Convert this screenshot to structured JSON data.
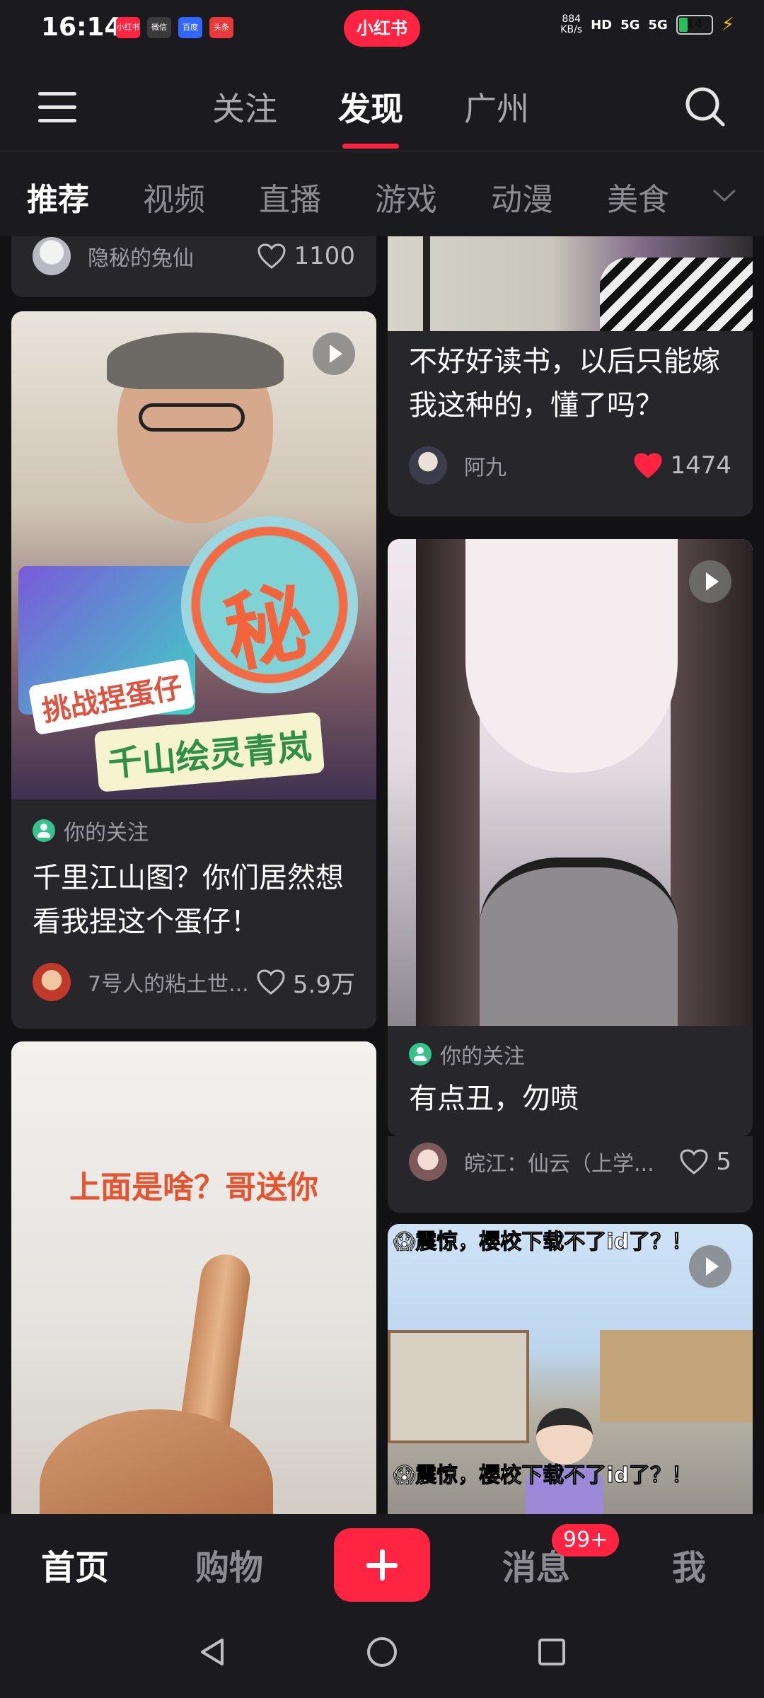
{
  "status_bar": {
    "time": "16:14",
    "app_icons": [
      {
        "name": "xiaohongshu-app-icon",
        "label": "小红书",
        "color": "#ff2442"
      },
      {
        "name": "wechat-app-icon",
        "label": "微信",
        "color": "#3a3a3a"
      },
      {
        "name": "baidu-app-icon",
        "label": "百度",
        "color": "#3366ff"
      },
      {
        "name": "toutiao-app-icon",
        "label": "头条",
        "color": "#e63939"
      }
    ],
    "brand_pill": "小红书",
    "net_speed_value": "884",
    "net_speed_unit": "KB/s",
    "hd_label": "HD",
    "signal_1": "5G",
    "signal_2": "5G",
    "battery": "14",
    "battery_level": 0.14
  },
  "header": {
    "tabs": [
      {
        "label": "关注",
        "active": false
      },
      {
        "label": "发现",
        "active": true
      },
      {
        "label": "广州",
        "active": false
      }
    ]
  },
  "categories": [
    {
      "label": "推荐",
      "active": true
    },
    {
      "label": "视频",
      "active": false
    },
    {
      "label": "直播",
      "active": false
    },
    {
      "label": "游戏",
      "active": false
    },
    {
      "label": "动漫",
      "active": false
    },
    {
      "label": "美食",
      "active": false
    }
  ],
  "feed": {
    "left": [
      {
        "author": "隐秘的兔仙",
        "likes": "1100",
        "liked": false
      },
      {
        "image_text_1": "秘",
        "image_text_2": "挑战捏蛋仔",
        "image_text_3": "千山绘灵青岚",
        "follow_tag": "你的关注",
        "title": "千里江山图？你们居然想看我捏这个蛋仔！",
        "author": "7号人的粘土世...",
        "likes": "5.9万",
        "liked": false,
        "video": true
      },
      {
        "image_text": "上面是啥？哥送你",
        "video": false
      }
    ],
    "right": [
      {
        "title": "不好好读书，以后只能嫁我这种的，懂了吗？",
        "author": "阿九",
        "likes": "1474",
        "liked": true
      },
      {
        "follow_tag": "你的关注",
        "title": "有点丑，勿喷",
        "author": "皖江：仙云（上学...",
        "likes": "5",
        "liked": false,
        "video": true
      },
      {
        "image_text_top": "😱震惊，樱校下载不了id了？！",
        "image_text_bottom": "😱震惊，樱校下载不了id了？！",
        "video": true
      }
    ]
  },
  "bottom_nav": {
    "items": [
      {
        "label": "首页",
        "active": true
      },
      {
        "label": "购物",
        "active": false
      },
      {
        "label": "消息",
        "active": false
      },
      {
        "label": "我",
        "active": false
      }
    ],
    "message_badge": "99+"
  },
  "colors": {
    "accent": "#ff2442",
    "background": "#1b1b1f",
    "card": "#26262b",
    "follow_green": "#35c28c"
  }
}
